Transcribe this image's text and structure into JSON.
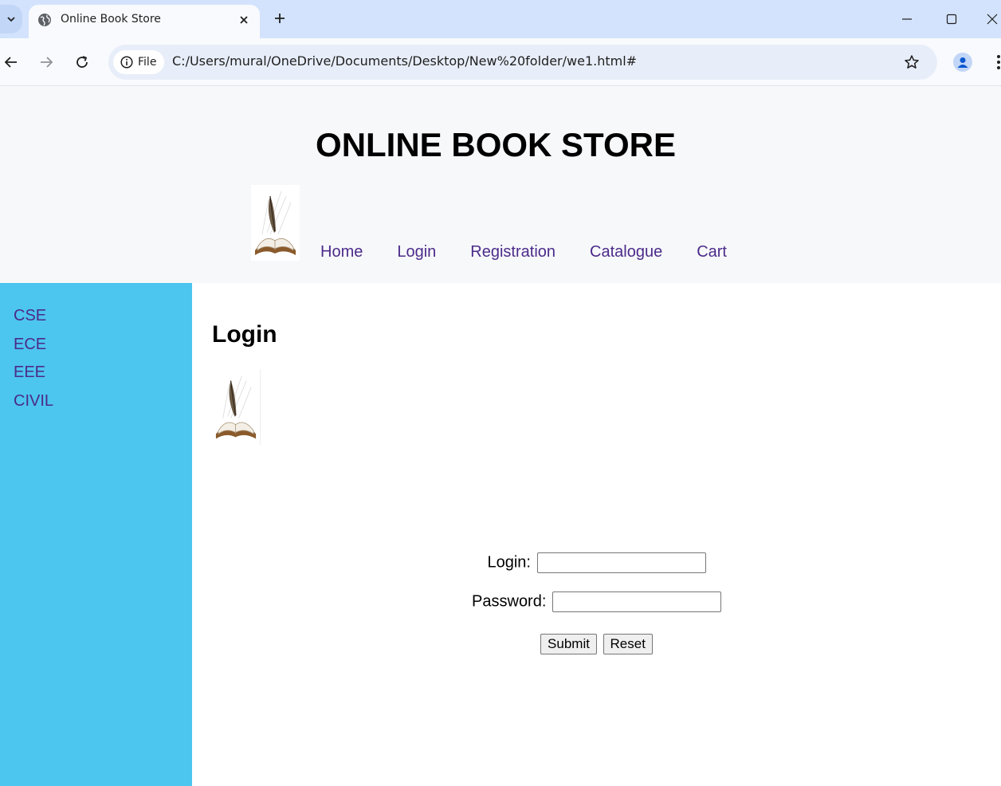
{
  "browser": {
    "tab_title": "Online Book Store",
    "address_chip": "File",
    "url": "C:/Users/mural/OneDrive/Documents/Desktop/New%20folder/we1.html#"
  },
  "header": {
    "title": "ONLINE BOOK STORE",
    "nav": [
      "Home",
      "Login",
      "Registration",
      "Catalogue",
      "Cart"
    ]
  },
  "sidebar": {
    "items": [
      "CSE",
      "ECE",
      "EEE",
      "CIVIL"
    ]
  },
  "main": {
    "heading": "Login",
    "form": {
      "login_label": "Login:",
      "login_value": "",
      "password_label": "Password:",
      "password_value": "",
      "submit_label": "Submit",
      "reset_label": "Reset"
    }
  },
  "colors": {
    "sidebar_bg": "#4cc5ef",
    "header_bg": "#f7f8fa",
    "link": "#4b2b8a",
    "tabstrip_bg": "#d3e3fd"
  }
}
